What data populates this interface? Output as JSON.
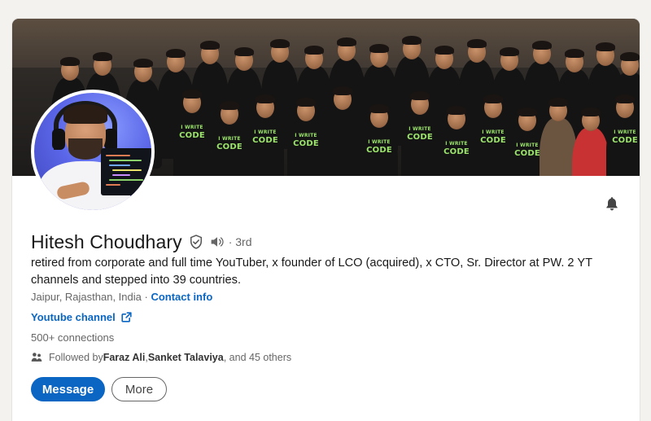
{
  "profile": {
    "name": "Hitesh Choudhary",
    "degree": "· 3rd",
    "headline": "retired from corporate and full time YouTuber, x founder of LCO (acquired), x CTO, Sr. Director at PW. 2 YT channels and stepped into 39 countries.",
    "location": "Jaipur, Rajasthan, India",
    "location_separator": " · ",
    "contact_info_label": "Contact info",
    "website_label": "Youtube channel",
    "connections": "500+ connections",
    "followed_by": {
      "prefix": "Followed by ",
      "person1": "Faraz Ali",
      "separator": ", ",
      "person2": "Sanket Talaviya",
      "suffix": ", and 45 others"
    }
  },
  "actions": {
    "message_label": "Message",
    "more_label": "More"
  },
  "banner": {
    "shirt_text_line1": "I WRITE",
    "shirt_text_line2": "CODE"
  },
  "icons": {
    "verified": "shield-check-icon",
    "pronunciation": "speaker-icon",
    "notifications": "bell-icon",
    "external_link": "external-link-icon",
    "followers": "people-icon"
  },
  "colors": {
    "link": "#0a66c2",
    "primary_button": "#0a66c2",
    "text_primary": "#191919",
    "text_secondary": "#666666",
    "page_background": "#f3f2ef"
  }
}
